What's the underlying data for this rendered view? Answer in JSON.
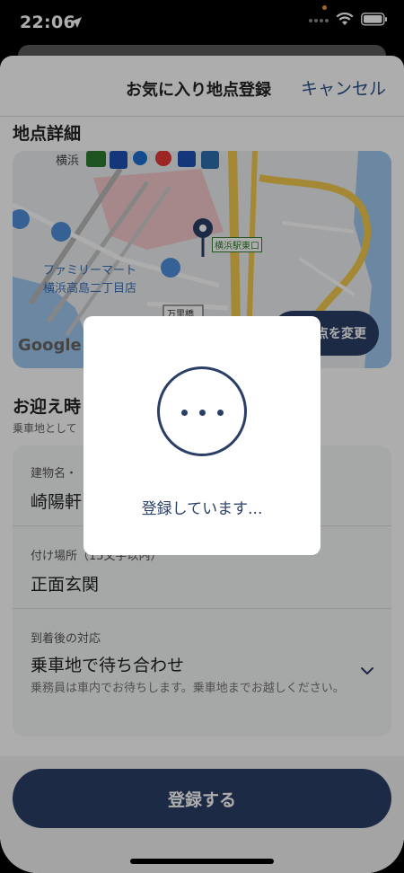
{
  "status_bar": {
    "time": "22:06"
  },
  "nav": {
    "title": "お気に入り地点登録",
    "cancel": "キャンセル"
  },
  "location": {
    "section_title": "地点詳細",
    "map": {
      "station": "横浜",
      "poi_1": "ファミリーマート",
      "poi_2": "横浜高島二丁目店",
      "exit": "横浜駅東口",
      "bridge": "万里橋",
      "logo": "Google"
    },
    "change_button": "点を変更"
  },
  "pickup": {
    "section_title": "お迎え時",
    "section_sub": "乗車地として",
    "building": {
      "label": "建物名・",
      "value": "崎陽軒"
    },
    "spot": {
      "label": "付け場所（15文字以内）",
      "value": "正面玄関"
    },
    "arrival": {
      "label": "到着後の対応",
      "value": "乗車地で待ち合わせ",
      "note": "乗務員は車内でお待ちします。乗車地までお越しください。"
    }
  },
  "footer": {
    "submit": "登録する"
  },
  "modal": {
    "text": "登録しています..."
  },
  "colors": {
    "primary": "#2b3f66",
    "link": "#2a5286",
    "rail": "#f2c94c"
  }
}
